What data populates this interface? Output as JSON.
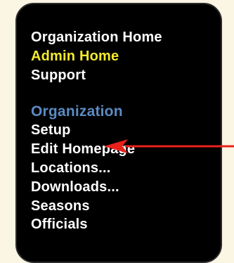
{
  "nav_top": {
    "items": [
      {
        "label": "Organization Home",
        "active": false
      },
      {
        "label": "Admin Home",
        "active": true
      },
      {
        "label": "Support",
        "active": false
      }
    ]
  },
  "organization_section": {
    "heading": "Organization",
    "items": [
      {
        "label": "Setup"
      },
      {
        "label": "Edit Homepage"
      },
      {
        "label": "Locations..."
      },
      {
        "label": "Downloads..."
      },
      {
        "label": "Seasons"
      },
      {
        "label": "Officials"
      }
    ]
  },
  "annotation": {
    "type": "arrow-pointer",
    "target": "Setup",
    "color": "#e8211b"
  },
  "colors": {
    "page_background": "#fbf5e4",
    "panel_background": "#000000",
    "text_default": "#ffffff",
    "text_active": "#f4ea2c",
    "section_heading": "#5b8bc2"
  }
}
